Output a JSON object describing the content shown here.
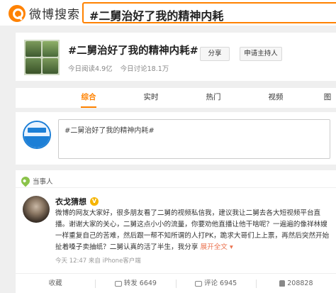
{
  "colors": {
    "accent": "#ff8200",
    "verified_blue": "#1d7fd6",
    "link": "#eb7350"
  },
  "header": {
    "logo_text": "微博搜索",
    "logo_icon": "weibo-search-icon",
    "search_value": "#二舅治好了我的精神内耗"
  },
  "topic": {
    "title": "#二舅治好了我的精神内耗#",
    "reads": "今日阅读4.9亿",
    "discussions": "今日讨论18.1万",
    "share_label": "分享",
    "host_label": "申请主持人"
  },
  "tabs": [
    {
      "label": "综合",
      "active": true
    },
    {
      "label": "实时",
      "active": false
    },
    {
      "label": "热门",
      "active": false
    },
    {
      "label": "视频",
      "active": false
    },
    {
      "label": "图",
      "active": false
    }
  ],
  "composer": {
    "value": "#二舅治好了我的精神内耗#"
  },
  "feed": {
    "section_label": "当事人",
    "section_icon": "location-pin-icon",
    "post": {
      "author": "衣戈猜想",
      "badge_icon": "vip-badge-icon",
      "text": "微博的网友大家好，很多朋友看了二舅的视频私信我，建议我让二舅去各大短视频平台直播。谢谢大家的关心，二舅这点小小的流量，你要劝他直播让他干啥呢？一遍遍的像祥林嫂一样重复自己的苦难，然后跟一帮不知所谓的人打PK，跪求大哥们上上票，再然后突然开始扯着嗓子卖抽纸？二舅认真的活了半生，我分享",
      "expand_label": "展开全文",
      "expand_icon": "chevron-down-icon",
      "meta": "今天 12:47  来自 iPhone客户端"
    },
    "actions": {
      "favorite": "收藏",
      "repost": "转发 6649",
      "comment": "评论 6945",
      "like": "208828"
    }
  }
}
